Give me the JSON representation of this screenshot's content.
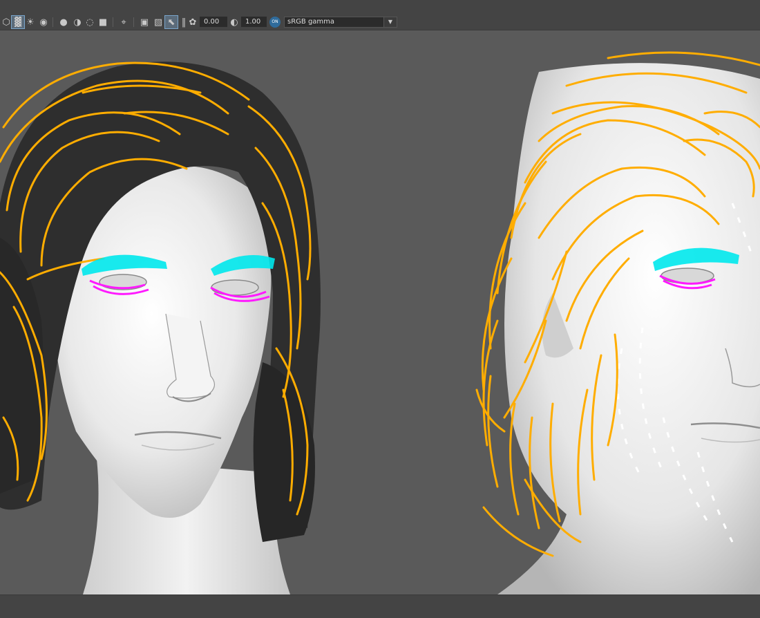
{
  "toolbar": {
    "exposure_value": "0.00",
    "gamma_value": "1.00",
    "view_transform": "sRGB gamma",
    "icons": [
      "cube-icon",
      "checker-icon",
      "light-bulb-icon",
      "camera-icon",
      "sphere-icon",
      "shaded-sphere-icon",
      "circle-icon",
      "grid-icon",
      "isolate-icon",
      "split-view-icon",
      "overlay-icon",
      "frame-icon",
      "pause-icon",
      "exposure-icon",
      "gamma-icon",
      "color-management-icon"
    ]
  },
  "colors": {
    "viewport_background": "#5a5a5a",
    "hair_guides": "#ffad00",
    "eyebrow_guides": "#00e8ec",
    "eyelash_guides": "#ff1aff",
    "toolbar_background": "#444444"
  }
}
